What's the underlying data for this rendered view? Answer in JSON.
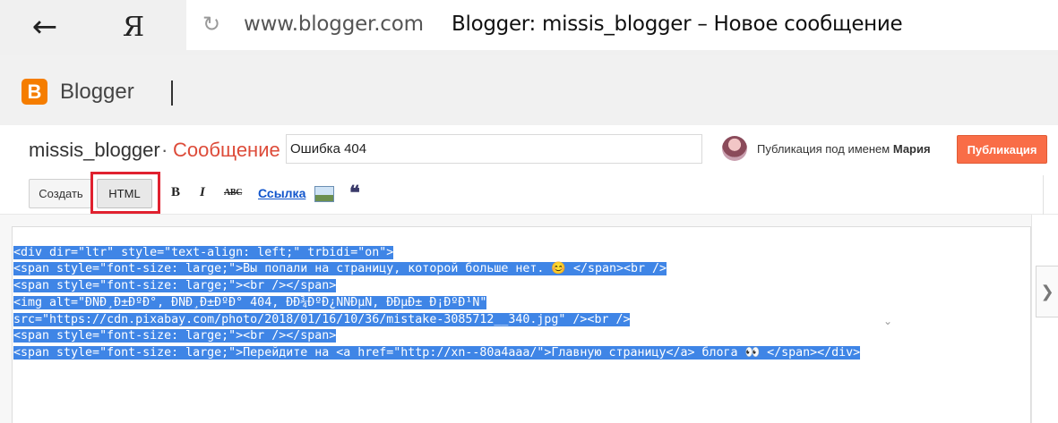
{
  "browser": {
    "back_icon": "arrow-left-icon",
    "back_glyph": "←",
    "yandex_logo": "Я",
    "reload_glyph": "↻",
    "url": "www.blogger.com",
    "page_title": "Blogger: missis_blogger – Новое сообщение"
  },
  "header": {
    "logo_letter": "B",
    "logo_text": "Blogger",
    "logo_color": "#f57d00"
  },
  "post_row": {
    "blog_name": "missis_blogger",
    "separator": "·",
    "section": "Сообщение",
    "title_value": "Ошибка 404",
    "published_as_prefix": "Публикация под именем",
    "author": "Мария",
    "publish_label": "Публикация",
    "publish_color": "#f96d47"
  },
  "toolbar": {
    "create_label": "Создать",
    "html_label": "HTML",
    "bold": "B",
    "italic": "I",
    "strike": "ABC",
    "link_label": "Ссылка",
    "quote": "❝"
  },
  "editor": {
    "lines": [
      "<div dir=\"ltr\" style=\"text-align: left;\" trbidi=\"on\">",
      "<span style=\"font-size: large;\">Вы попали на страницу, которой больше нет. 😊 </span><br />",
      "<span style=\"font-size: large;\"><br /></span>",
      "<img alt=\"ÐÑÐ¸Ð±ÐºÐ°, ÐÑÐ¸Ð±ÐºÐ° 404, ÐÐ¾ÐºÐ¿ÑÑÐµÑ, ÐÐµÐ± Ð¡ÐºÐ¹Ñ\"",
      "src=\"https://cdn.pixabay.com/photo/2018/01/16/10/36/mistake-3085712__340.jpg\" /><br />",
      "<span style=\"font-size: large;\"><br /></span>",
      "<span style=\"font-size: large;\">Перейдите на <a href=\"http://xn--80a4aaa/\">Главную страницу</a> блога 👀 </span></div>"
    ],
    "selection_color": "#3f85e6"
  },
  "side": {
    "collapse_glyph": "❯",
    "chevron_glyph": "⌄"
  }
}
